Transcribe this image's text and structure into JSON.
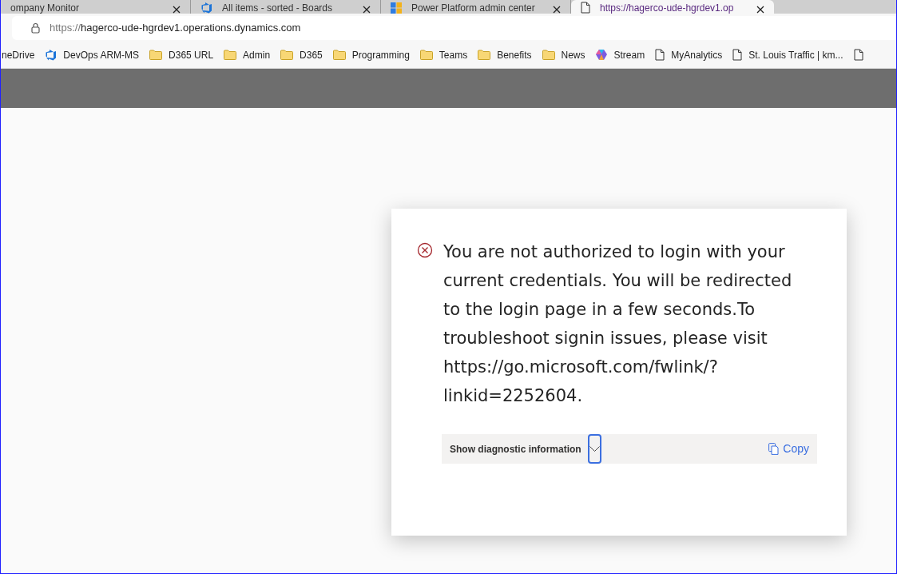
{
  "tabs": [
    {
      "title": "ompany Monitor",
      "kind": "none",
      "selected": false
    },
    {
      "title": "All items - sorted - Boards",
      "kind": "devops",
      "selected": false
    },
    {
      "title": "Power Platform admin center",
      "kind": "tiles",
      "selected": false
    },
    {
      "title": "https://hagerco-ude-hgrdev1.op",
      "kind": "page",
      "selected": true
    }
  ],
  "address_bar": {
    "scheme": "https://",
    "host": "hagerco-ude-hgrdev1.operations.dynamics.com"
  },
  "bookmarks": [
    {
      "label": "neDrive",
      "kind": "none"
    },
    {
      "label": "DevOps ARM-MS",
      "kind": "devops"
    },
    {
      "label": "D365 URL",
      "kind": "folder"
    },
    {
      "label": "Admin",
      "kind": "folder"
    },
    {
      "label": "D365",
      "kind": "folder"
    },
    {
      "label": "Programming",
      "kind": "folder"
    },
    {
      "label": "Teams",
      "kind": "folder"
    },
    {
      "label": "Benefits",
      "kind": "folder"
    },
    {
      "label": "News",
      "kind": "folder"
    },
    {
      "label": "Stream",
      "kind": "copilot"
    },
    {
      "label": "MyAnalytics",
      "kind": "page"
    },
    {
      "label": "St. Louis Traffic | km...",
      "kind": "page"
    },
    {
      "kind": "page"
    }
  ],
  "dialog": {
    "message": "You are not authorized to login with your current credentials. You will be redirected to the login page in a few seconds.To troubleshoot signin issues, please visit https://go.microsoft.com/fwlink/?linkid=2252604.",
    "diagnostics": {
      "label": "Show diagnostic information",
      "expanded": false,
      "copy": "Copy"
    }
  }
}
